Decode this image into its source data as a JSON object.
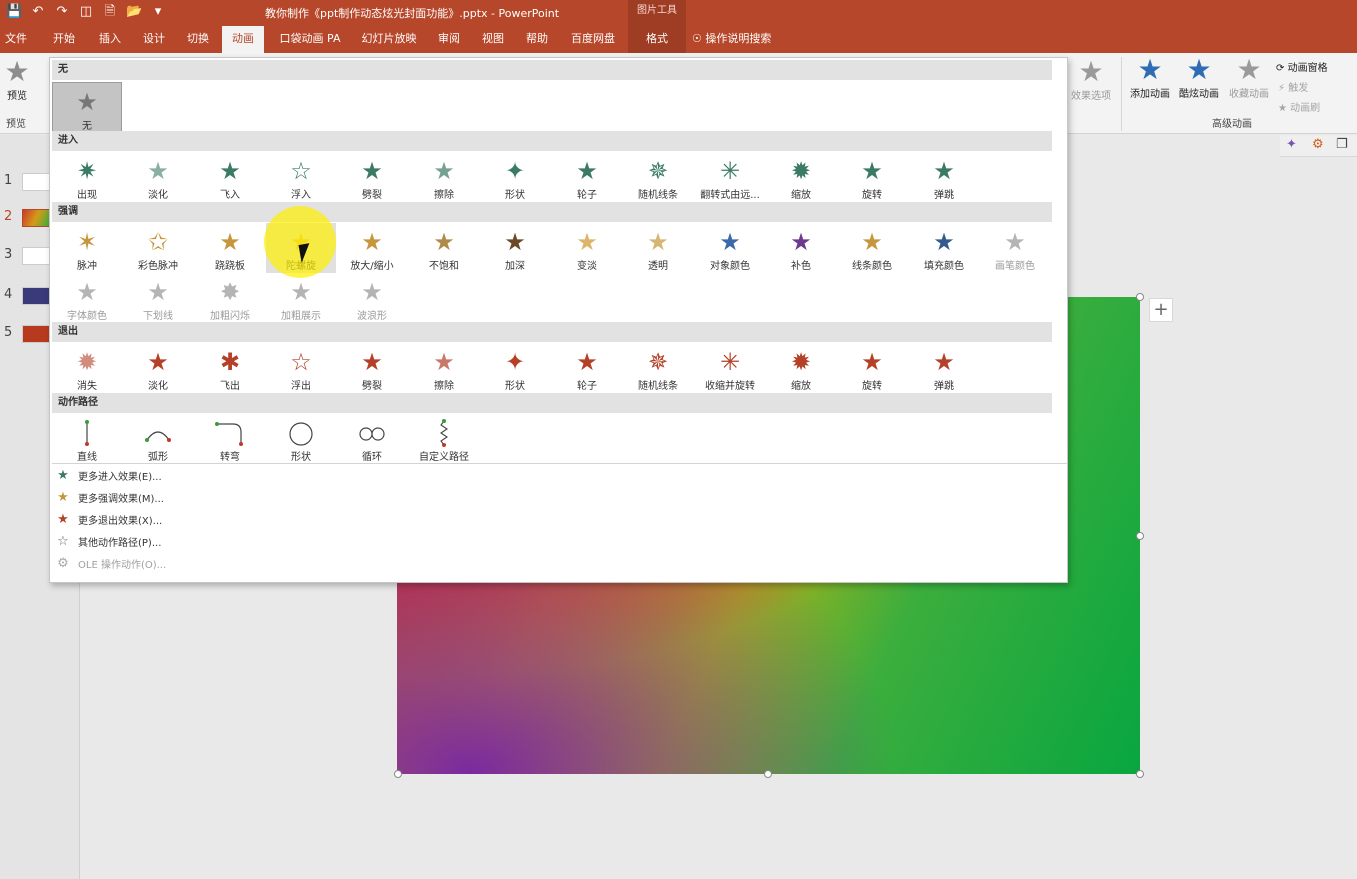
{
  "title_bar": {
    "qat_icons": [
      "save-icon",
      "undo-icon",
      "redo-icon",
      "start-from-beginning-icon",
      "new-icon",
      "open-icon",
      "customize-icon"
    ],
    "doc_title": "教你制作《ppt制作动态炫光封面功能》.pptx  -  PowerPoint",
    "context_tools": "图片工具"
  },
  "tabs": [
    {
      "label": "文件"
    },
    {
      "label": "开始"
    },
    {
      "label": "插入"
    },
    {
      "label": "设计"
    },
    {
      "label": "切换"
    },
    {
      "label": "动画",
      "active": true
    },
    {
      "label": "口袋动画 PA"
    },
    {
      "label": "幻灯片放映"
    },
    {
      "label": "审阅"
    },
    {
      "label": "视图"
    },
    {
      "label": "帮助"
    },
    {
      "label": "百度网盘"
    },
    {
      "label": "格式",
      "context": true
    },
    {
      "label": "操作说明搜索",
      "icon": "lightbulb-icon"
    }
  ],
  "ribbon": {
    "preview_label": "预览",
    "preview_group": "预览",
    "effect_options": "效果选项",
    "add_animation": "添加动画",
    "cool_animation": "酷炫动画",
    "collect_animation": "收藏动画",
    "animation_pane": "动画窗格",
    "trigger": "触发",
    "animation_painter": "动画刷",
    "advanced_group": "高级动画"
  },
  "thumbnails": [
    {
      "num": "1"
    },
    {
      "num": "2",
      "current": true
    },
    {
      "num": "3"
    },
    {
      "num": "4"
    },
    {
      "num": "5"
    }
  ],
  "gallery": {
    "none": {
      "header": "无",
      "items": [
        {
          "label": "无",
          "selected": true
        }
      ]
    },
    "entrance": {
      "header": "进入",
      "items": [
        {
          "label": "出现"
        },
        {
          "label": "淡化"
        },
        {
          "label": "飞入"
        },
        {
          "label": "浮入"
        },
        {
          "label": "劈裂"
        },
        {
          "label": "擦除"
        },
        {
          "label": "形状"
        },
        {
          "label": "轮子"
        },
        {
          "label": "随机线条"
        },
        {
          "label": "翻转式由远..."
        },
        {
          "label": "缩放"
        },
        {
          "label": "旋转"
        },
        {
          "label": "弹跳"
        }
      ]
    },
    "emphasis": {
      "header": "强调",
      "items": [
        {
          "label": "脉冲"
        },
        {
          "label": "彩色脉冲"
        },
        {
          "label": "跷跷板"
        },
        {
          "label": "陀螺旋",
          "hover": true
        },
        {
          "label": "放大/缩小"
        },
        {
          "label": "不饱和"
        },
        {
          "label": "加深"
        },
        {
          "label": "变淡"
        },
        {
          "label": "透明"
        },
        {
          "label": "对象颜色"
        },
        {
          "label": "补色"
        },
        {
          "label": "线条颜色"
        },
        {
          "label": "填充颜色"
        },
        {
          "label": "画笔颜色",
          "disabled": true
        },
        {
          "label": "字体颜色",
          "disabled": true
        },
        {
          "label": "下划线",
          "disabled": true
        },
        {
          "label": "加粗闪烁",
          "disabled": true
        },
        {
          "label": "加粗展示",
          "disabled": true
        },
        {
          "label": "波浪形",
          "disabled": true
        }
      ]
    },
    "exit": {
      "header": "退出",
      "items": [
        {
          "label": "消失"
        },
        {
          "label": "淡化"
        },
        {
          "label": "飞出"
        },
        {
          "label": "浮出"
        },
        {
          "label": "劈裂"
        },
        {
          "label": "擦除"
        },
        {
          "label": "形状"
        },
        {
          "label": "轮子"
        },
        {
          "label": "随机线条"
        },
        {
          "label": "收缩并旋转"
        },
        {
          "label": "缩放"
        },
        {
          "label": "旋转"
        },
        {
          "label": "弹跳"
        }
      ]
    },
    "motion": {
      "header": "动作路径",
      "items": [
        {
          "label": "直线",
          "icon": "line-path-icon"
        },
        {
          "label": "弧形",
          "icon": "arc-path-icon"
        },
        {
          "label": "转弯",
          "icon": "turn-path-icon"
        },
        {
          "label": "形状",
          "icon": "circle-path-icon"
        },
        {
          "label": "循环",
          "icon": "loop-path-icon"
        },
        {
          "label": "自定义路径",
          "icon": "custom-path-icon"
        }
      ]
    },
    "more": [
      {
        "label": "更多进入效果(E)...",
        "icon": "entrance-star-icon"
      },
      {
        "label": "更多强调效果(M)...",
        "icon": "emphasis-star-icon"
      },
      {
        "label": "更多退出效果(X)...",
        "icon": "exit-star-icon"
      },
      {
        "label": "其他动作路径(P)...",
        "icon": "outline-star-icon"
      },
      {
        "label": "OLE 操作动作(O)...",
        "icon": "ole-icon",
        "disabled": true
      }
    ]
  }
}
